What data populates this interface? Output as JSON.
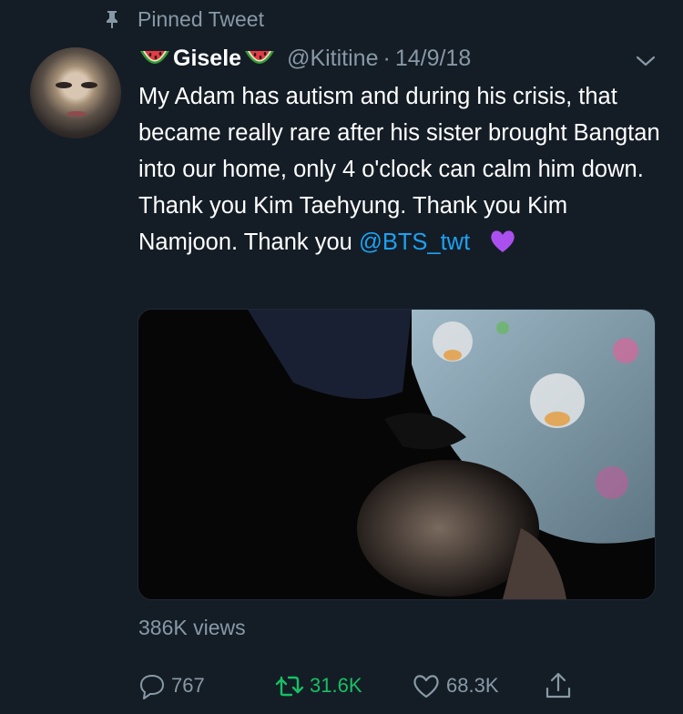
{
  "pinned_label": "Pinned Tweet",
  "author": {
    "name": "Gisele",
    "handle": "@Kititine",
    "separator": "·",
    "date": "14/9/18"
  },
  "tweet": {
    "text_before_mention": "My Adam has autism and during his crisis, that became really rare after his sister brought Bangtan into our home, only 4 o'clock can calm him down. Thank you Kim Taehyung. Thank you Kim Namjoon. Thank you",
    "mention": "@BTS_twt",
    "emoji": "purple-heart"
  },
  "views": "386K views",
  "actions": {
    "replies": "767",
    "retweets": "31.6K",
    "likes": "68.3K"
  },
  "colors": {
    "background": "#141d26",
    "secondary_text": "#8899a6",
    "link": "#1da1f2",
    "retweet_active": "#17bf63"
  },
  "icons": [
    "pin-icon",
    "watermelon-icon",
    "chevron-down-icon",
    "purple-heart-icon",
    "reply-icon",
    "retweet-icon",
    "like-icon",
    "share-icon"
  ]
}
